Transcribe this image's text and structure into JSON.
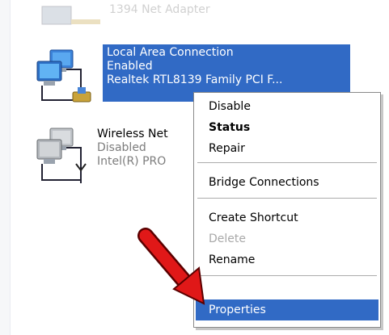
{
  "connections": [
    {
      "line1": "1394 Net Adapter"
    },
    {
      "line1": "Local Area Connection",
      "line2": "Enabled",
      "line3": "Realtek RTL8139 Family PCI F..."
    },
    {
      "line1": "Wireless Net",
      "line2": "Disabled",
      "line3": "Intel(R) PRO"
    }
  ],
  "context_menu": {
    "items": [
      {
        "label": "Disable"
      },
      {
        "label": "Status"
      },
      {
        "label": "Repair"
      },
      {
        "label": "Bridge Connections"
      },
      {
        "label": "Create Shortcut"
      },
      {
        "label": "Delete"
      },
      {
        "label": "Rename"
      },
      {
        "label": "Properties"
      }
    ]
  },
  "colors": {
    "selection": "#316ac5",
    "arrow": "#e01818"
  },
  "icons": {
    "network": "network-computer-icon",
    "wireless": "wireless-computer-icon",
    "arrow": "red-arrow-pointer"
  }
}
